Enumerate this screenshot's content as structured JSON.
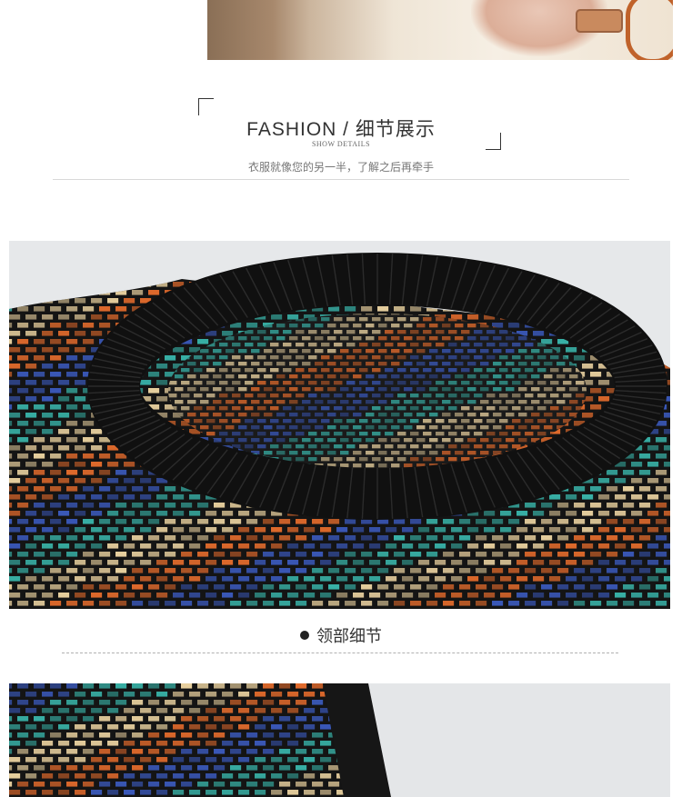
{
  "header": {
    "title": "FASHION / 细节展示",
    "subtitle": "SHOW DETAILS",
    "description": "衣服就像您的另一半，了解之后再牵手"
  },
  "detail_section": {
    "caption": "领部细节"
  },
  "colors": {
    "knit_dark": "#141414",
    "stripe_orange": "#e06a2c",
    "stripe_blue": "#3a58b8",
    "stripe_teal": "#38b0a6",
    "stripe_cream": "#e7cf9e",
    "background": "#e6e8ea"
  }
}
